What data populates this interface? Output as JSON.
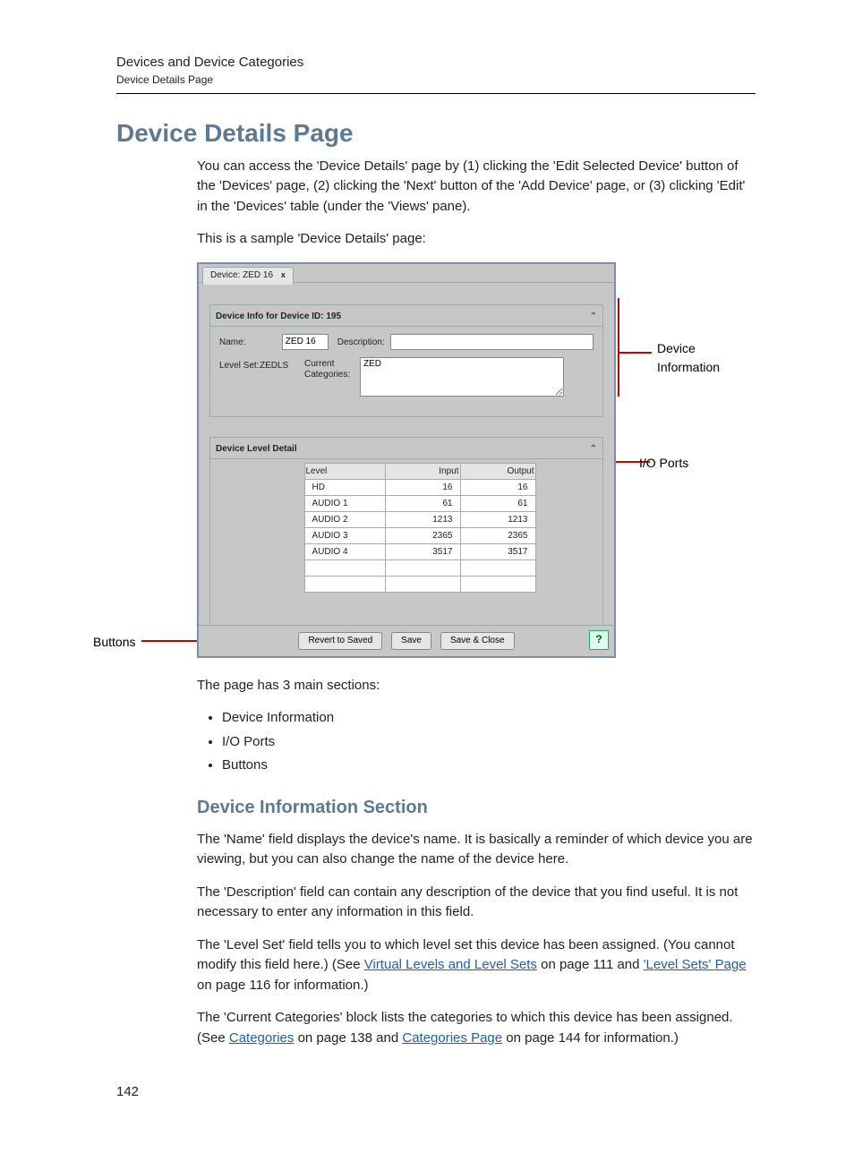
{
  "header": {
    "chapter": "Devices and Device Categories",
    "section": "Device Details Page"
  },
  "title": "Device Details Page",
  "intro": {
    "p1": "You can access the 'Device Details' page by (1) clicking the 'Edit Selected Device' button of the 'Devices' page, (2) clicking the 'Next' button of the 'Add Device' page, or (3) clicking 'Edit' in the 'Devices' table (under the 'Views' pane).",
    "p2": "This is a sample 'Device Details' page:"
  },
  "figure": {
    "tab_label": "Device: ZED 16",
    "info_header": "Device Info for Device ID: 195",
    "name_label": "Name:",
    "name_value": "ZED 16",
    "desc_label": "Description:",
    "desc_value": "",
    "levelset_label": "Level Set:",
    "levelset_value": "ZEDLS",
    "curcat_label": "Current Categories:",
    "curcat_value": "ZED",
    "detail_header": "Device Level Detail",
    "columns": {
      "level": "Level",
      "input": "Input",
      "output": "Output"
    },
    "rows": [
      {
        "level": "HD",
        "input": "16",
        "output": "16"
      },
      {
        "level": "AUDIO 1",
        "input": "61",
        "output": "61"
      },
      {
        "level": "AUDIO 2",
        "input": "1213",
        "output": "1213"
      },
      {
        "level": "AUDIO 3",
        "input": "2365",
        "output": "2365"
      },
      {
        "level": "AUDIO 4",
        "input": "3517",
        "output": "3517"
      }
    ],
    "buttons": {
      "revert": "Revert to Saved",
      "save": "Save",
      "save_close": "Save & Close",
      "help": "?"
    },
    "callouts": {
      "device_info_line1": "Device",
      "device_info_line2": "Information",
      "io_ports": "I/O Ports",
      "buttons": "Buttons"
    }
  },
  "after_figure": {
    "intro": "The page has 3 main sections:",
    "items": [
      "Device Information",
      "I/O Ports",
      "Buttons"
    ]
  },
  "subsection": {
    "title": "Device Information Section",
    "p1": "The 'Name' field displays the device's name. It is basically a reminder of which device you are viewing, but you can also change the name of the device here.",
    "p2": "The 'Description' field can contain any description of the device that you find useful. It is not necessary to enter any information in this field.",
    "p3_pre": "The 'Level Set' field tells you to which level set this device has been assigned. (You cannot modify this field here.) (See ",
    "p3_link1": "Virtual Levels and Level Sets",
    "p3_mid1": " on page 111 and ",
    "p3_link2": "'Level Sets' Page",
    "p3_post": " on page 116 for information.)",
    "p4_pre": "The 'Current Categories' block lists the categories to which this device has been assigned. (See ",
    "p4_link1": "Categories",
    "p4_mid1": " on page 138 and ",
    "p4_link2": "Categories Page",
    "p4_post": " on page 144 for information.)"
  },
  "page_number": "142"
}
